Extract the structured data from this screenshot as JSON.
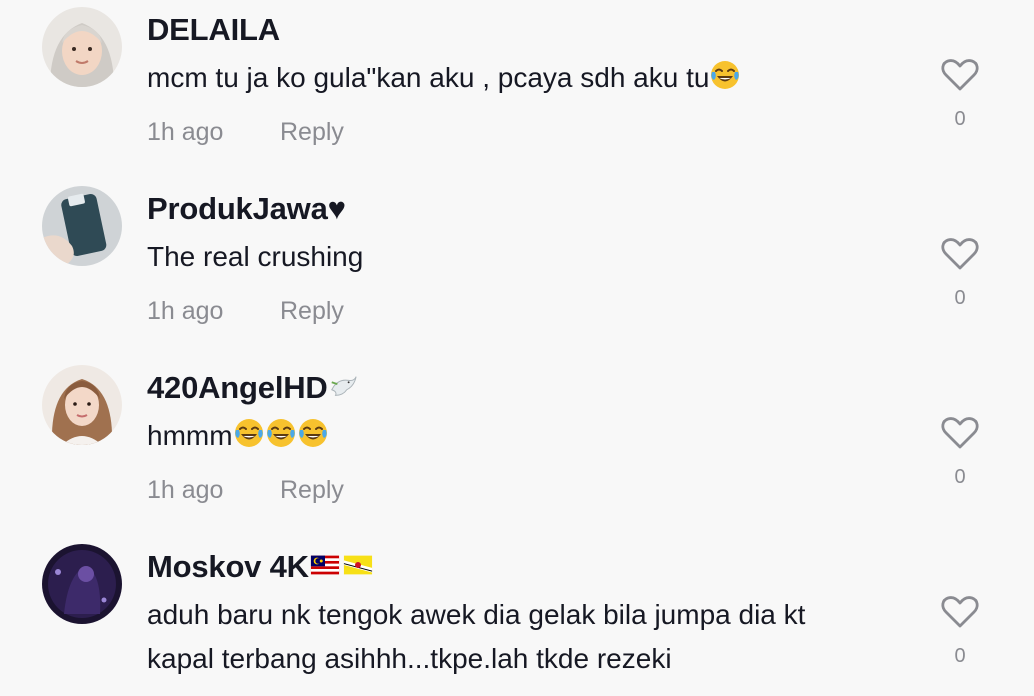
{
  "icons": {
    "like": "heart-outline-icon",
    "emoji_laugh": "face-with-tears-of-joy",
    "emoji_dove": "dove-of-peace",
    "emoji_flag_my": "flag-malaysia",
    "emoji_flag_bn": "flag-brunei"
  },
  "comments": [
    {
      "username": "DELAILA",
      "text": "mcm tu ja ko gula\"kan aku , pcaya sdh aku tu",
      "time": "1h ago",
      "reply_label": "Reply",
      "likes": "0"
    },
    {
      "username": "ProdukJawa♥",
      "text": "The real crushing",
      "time": "1h ago",
      "reply_label": "Reply",
      "likes": "0"
    },
    {
      "username": "420AngelHD",
      "text": "hmmm",
      "time": "1h ago",
      "reply_label": "Reply",
      "likes": "0"
    },
    {
      "username": "Moskov 4K",
      "text_line1": "aduh baru nk tengok awek dia gelak bila jumpa dia kt",
      "text_line2": "kapal terbang asihhh...tkpe.lah tkde rezeki",
      "likes": "0"
    }
  ]
}
